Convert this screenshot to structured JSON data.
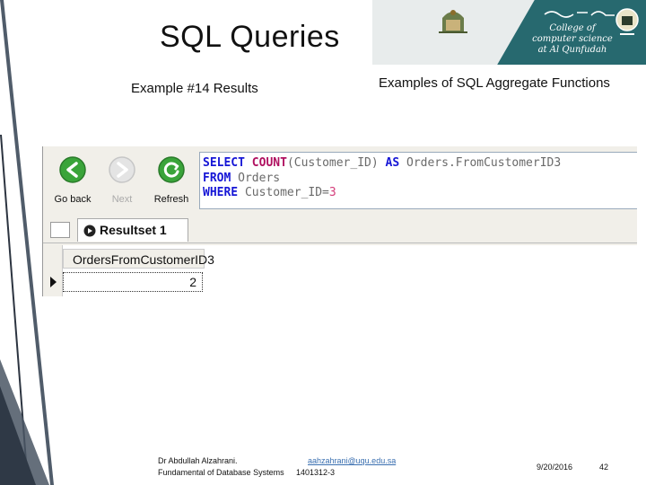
{
  "slide": {
    "title": "SQL Queries",
    "subtitle": "Example #14 Results",
    "section_title": "Examples of SQL Aggregate Functions"
  },
  "banner": {
    "college_line1": "College of computer science",
    "college_line2": "at Al Qunfudah"
  },
  "toolbar": {
    "go_back": "Go back",
    "next": "Next",
    "refresh": "Refresh"
  },
  "sql": {
    "line1": {
      "kw1": "SELECT",
      "fn": "COUNT",
      "args": "(Customer_ID)",
      "kw2": "AS",
      "alias": "Orders.FromCustomerID3"
    },
    "line2": {
      "kw": "FROM",
      "table": "Orders"
    },
    "line3": {
      "kw": "WHERE",
      "cond": "Customer_ID=",
      "val": "3"
    }
  },
  "resultset": {
    "tab_label": "Resultset 1",
    "column_header": "OrdersFromCustomerID3",
    "value": "2"
  },
  "footer": {
    "author": "Dr Abdullah Alzahrani.",
    "email": "aahzahrani@uqu.edu.sa",
    "course": "Fundamental of Database Systems",
    "code": "1401312-3",
    "date": "9/20/2016",
    "page": "42"
  },
  "colors": {
    "banner": "#27696f",
    "keyword": "#1616d6",
    "function": "#b01060",
    "number": "#d43d7a",
    "back_icon": "#3aa43a",
    "refresh_icon": "#3aa43a"
  }
}
